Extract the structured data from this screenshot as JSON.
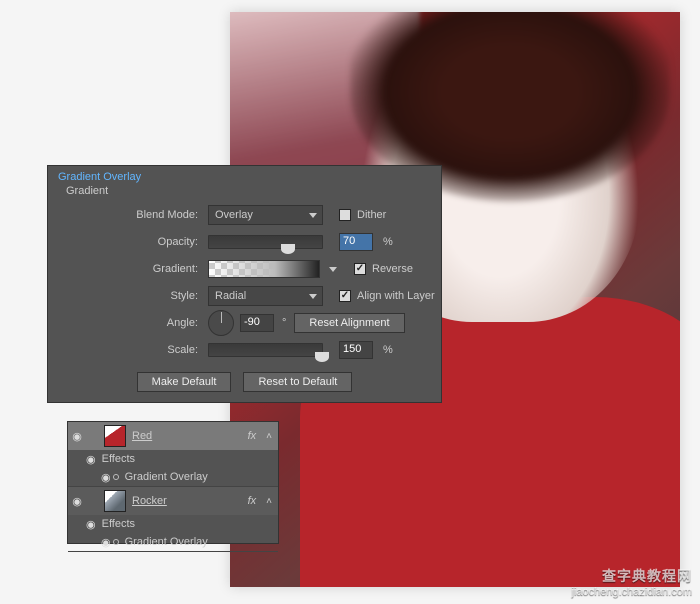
{
  "panel": {
    "title": "Gradient Overlay",
    "subtitle": "Gradient",
    "blendMode": {
      "label": "Blend Mode:",
      "value": "Overlay"
    },
    "dither": {
      "label": "Dither",
      "checked": false
    },
    "opacity": {
      "label": "Opacity:",
      "value": "70",
      "pct": "%"
    },
    "gradient": {
      "label": "Gradient:"
    },
    "reverse": {
      "label": "Reverse",
      "checked": true
    },
    "style": {
      "label": "Style:",
      "value": "Radial"
    },
    "align": {
      "label": "Align with Layer",
      "checked": true
    },
    "angle": {
      "label": "Angle:",
      "value": "-90",
      "deg": "°"
    },
    "resetAlign": "Reset Alignment",
    "scale": {
      "label": "Scale:",
      "value": "150",
      "pct": "%"
    },
    "makeDefault": "Make Default",
    "resetDefault": "Reset to Default"
  },
  "layers": {
    "items": [
      {
        "name": "Red",
        "fx": "fx",
        "sub1": "Effects",
        "sub2": "Gradient Overlay"
      },
      {
        "name": "Rocker",
        "fx": "fx",
        "sub1": "Effects",
        "sub2": "Gradient Overlay"
      }
    ]
  },
  "watermark": {
    "cn": "查字典教程网",
    "url": "jiaocheng.chazidian.com"
  }
}
